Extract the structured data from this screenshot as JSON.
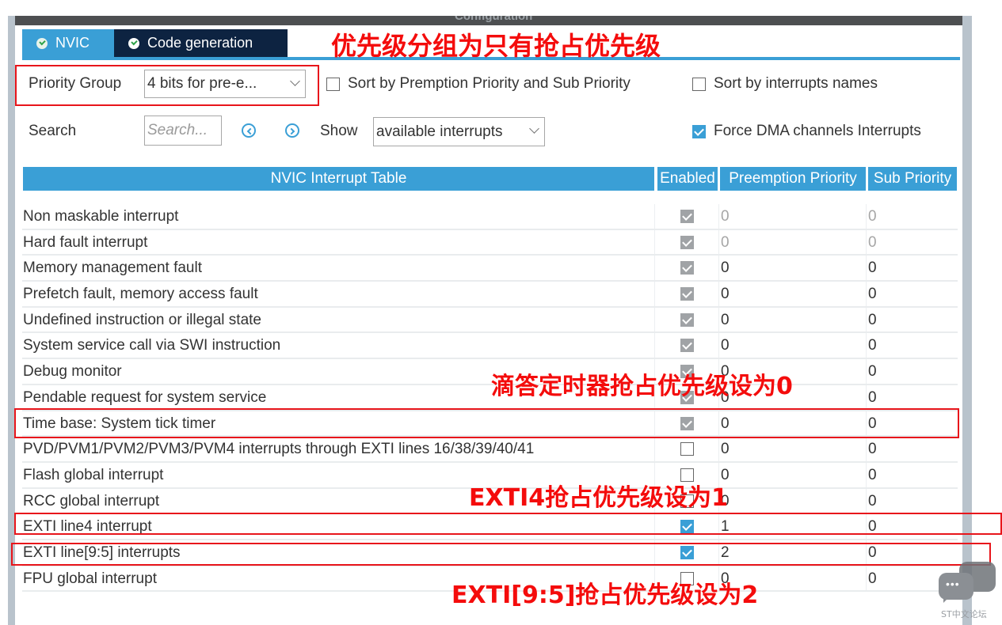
{
  "window": {
    "title": "Configuration"
  },
  "tabs": [
    {
      "label": "NVIC",
      "status": "ok",
      "active": true
    },
    {
      "label": "Code generation",
      "status": "ok",
      "active": false
    }
  ],
  "toolbar": {
    "priority_group_label": "Priority Group",
    "priority_group_value": "4 bits for pre-e...",
    "sort_premption_label": "Sort by Premption Priority and Sub Priority",
    "sort_premption_checked": false,
    "sort_names_label": "Sort by interrupts names",
    "sort_names_checked": false,
    "search_label": "Search",
    "search_placeholder": "Search...",
    "search_value": "",
    "show_label": "Show",
    "show_value": "available interrupts",
    "force_dma_label": "Force DMA channels Interrupts",
    "force_dma_checked": true
  },
  "table": {
    "headers": {
      "name": "NVIC Interrupt Table",
      "enabled": "Enabled",
      "preemption": "Preemption Priority",
      "sub": "Sub Priority"
    },
    "rows": [
      {
        "name": "Non maskable interrupt",
        "enabled": "locked-checked",
        "preemption": "0",
        "sub": "0",
        "editable": false
      },
      {
        "name": "Hard fault interrupt",
        "enabled": "locked-checked",
        "preemption": "0",
        "sub": "0",
        "editable": false
      },
      {
        "name": "Memory management fault",
        "enabled": "locked-checked",
        "preemption": "0",
        "sub": "0",
        "editable": true
      },
      {
        "name": "Prefetch fault, memory access fault",
        "enabled": "locked-checked",
        "preemption": "0",
        "sub": "0",
        "editable": true
      },
      {
        "name": "Undefined instruction or illegal state",
        "enabled": "locked-checked",
        "preemption": "0",
        "sub": "0",
        "editable": true
      },
      {
        "name": "System service call via SWI instruction",
        "enabled": "locked-checked",
        "preemption": "0",
        "sub": "0",
        "editable": true
      },
      {
        "name": "Debug monitor",
        "enabled": "locked-checked",
        "preemption": "0",
        "sub": "0",
        "editable": true
      },
      {
        "name": "Pendable request for system service",
        "enabled": "locked-checked",
        "preemption": "0",
        "sub": "0",
        "editable": true
      },
      {
        "name": "Time base: System tick timer",
        "enabled": "locked-checked",
        "preemption": "0",
        "sub": "0",
        "editable": true
      },
      {
        "name": "PVD/PVM1/PVM2/PVM3/PVM4 interrupts through EXTI lines 16/38/39/40/41",
        "enabled": "unchecked",
        "preemption": "0",
        "sub": "0",
        "editable": true
      },
      {
        "name": "Flash global interrupt",
        "enabled": "unchecked",
        "preemption": "0",
        "sub": "0",
        "editable": true
      },
      {
        "name": "RCC global interrupt",
        "enabled": "unchecked",
        "preemption": "0",
        "sub": "0",
        "editable": true
      },
      {
        "name": "EXTI line4 interrupt",
        "enabled": "checked",
        "preemption": "1",
        "sub": "0",
        "editable": true
      },
      {
        "name": "EXTI line[9:5] interrupts",
        "enabled": "checked",
        "preemption": "2",
        "sub": "0",
        "editable": true
      },
      {
        "name": "FPU global interrupt",
        "enabled": "unchecked",
        "preemption": "0",
        "sub": "0",
        "editable": true
      }
    ]
  },
  "annotations": {
    "priority_group": "优先级分组为只有抢占优先级",
    "systick": "滴答定时器抢占优先级设为0",
    "exti4": "EXTI4抢占优先级设为1",
    "exti9_5": "EXTI[9:5]抢占优先级设为2"
  },
  "watermark": "ST中文论坛",
  "colors": {
    "accent": "#3a9fd6",
    "tab_dark": "#0d2341",
    "annotation_red": "#f40c0c",
    "locked_checkbox": "#a0a3a6"
  }
}
